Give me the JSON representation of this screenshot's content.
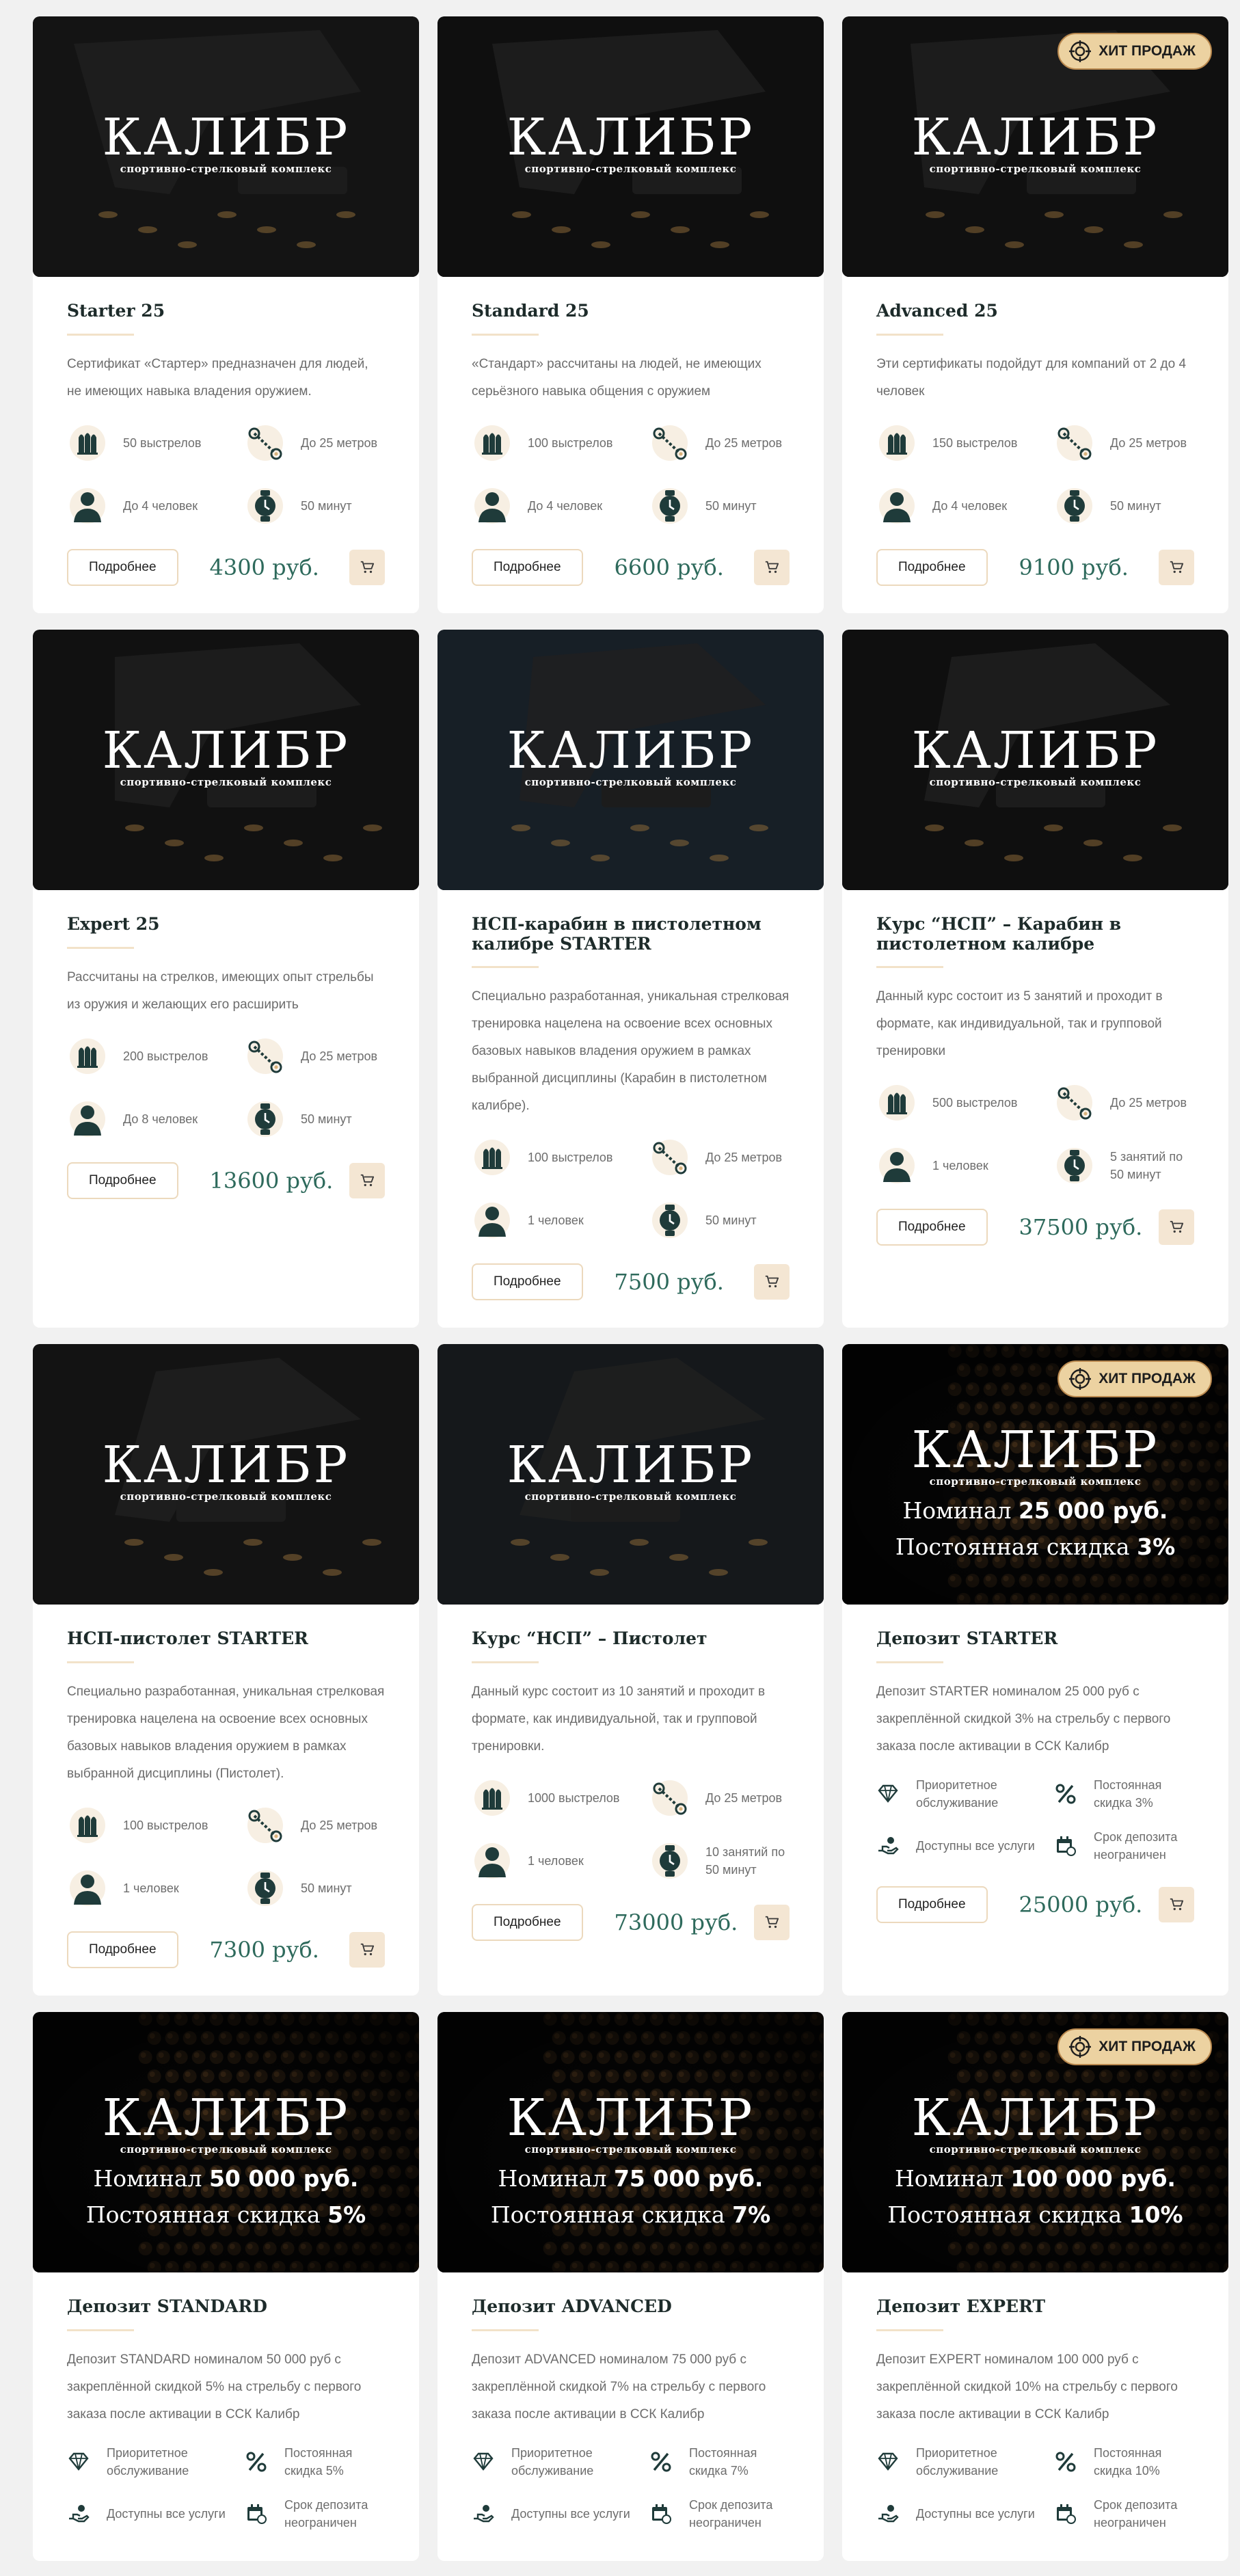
{
  "common": {
    "logo_title": "КАЛИБР",
    "logo_sub": "спортивно-стрелковый комплекс",
    "more_label": "Подробнее",
    "badge_label": "ХИТ ПРОДАЖ",
    "colors": {
      "accent": "#ecd2a1",
      "price": "#2e6a5c",
      "icon": "#1f3b3a",
      "cart_bg": "#f4e6d3"
    }
  },
  "cards": [
    {
      "title": "Starter 25",
      "desc": "Сертификат «Стартер» предназначен для людей, не имеющих навыка владения оружием.",
      "feats": [
        "50 выстрелов",
        "До 25 метров",
        "До 4 человек",
        "50 минут"
      ],
      "price": "4300 руб.",
      "badge": false
    },
    {
      "title": "Standard 25",
      "desc": "«Стандарт» рассчитаны на людей, не имеющих серьёзного навыка общения с оружием",
      "feats": [
        "100 выстрелов",
        "До 25 метров",
        "До 4 человек",
        "50 минут"
      ],
      "price": "6600 руб.",
      "badge": false
    },
    {
      "title": "Advanced 25",
      "desc": "Эти сертификаты подойдут для компаний от 2 до 4 человек",
      "feats": [
        "150 выстрелов",
        "До 25 метров",
        "До 4 человек",
        "50 минут"
      ],
      "price": "9100 руб.",
      "badge": true
    },
    {
      "title": "Expert 25",
      "desc": "Рассчитаны на стрелков, имеющих опыт стрельбы из оружия и желающих его расширить",
      "feats": [
        "200 выстрелов",
        "До 25 метров",
        "До 8 человек",
        "50 минут"
      ],
      "price": "13600 руб.",
      "badge": false
    },
    {
      "title": "НСП-карабин в пистолетном калибре STARTER",
      "desc": "Специально разработанная, уникальная стрелковая тренировка нацелена на освоение всех основных базовых навыков владения оружием в рамках выбранной дисциплины (Карабин в пистолетном калибре).",
      "feats": [
        "100 выстрелов",
        "До 25 метров",
        "1 человек",
        "50 минут"
      ],
      "price": "7500 руб.",
      "badge": false
    },
    {
      "title": "Курс “НСП” – Карабин в пистолетном калибре",
      "desc": "Данный курс состоит из 5 занятий и проходит в формате, как индивидуальной, так и групповой тренировки",
      "feats": [
        "500 выстрелов",
        "До 25 метров",
        "1 человек",
        "5 занятий по 50 минут"
      ],
      "price": "37500 руб.",
      "badge": false
    },
    {
      "title": "НСП-пистолет STARTER",
      "desc": "Специально разработанная, уникальная стрелковая тренировка нацелена на освоение всех основных базовых навыков владения оружием в рамках выбранной дисциплины (Пистолет).",
      "feats": [
        "100 выстрелов",
        "До 25 метров",
        "1 человек",
        "50 минут"
      ],
      "price": "7300 руб.",
      "badge": false
    },
    {
      "title": "Курс “НСП” – Пистолет",
      "desc": "Данный курс состоит из 10 занятий и проходит в формате, как индивидуальной, так и групповой тренировки.",
      "feats": [
        "1000 выстрелов",
        "До 25 метров",
        "1 человек",
        "10 занятий по 50 минут"
      ],
      "price": "73000 руб.",
      "badge": false
    },
    {
      "title": "Депозит STARTER",
      "desc": "Депозит STARTER номиналом 25 000 руб с закреплённой скидкой 3% на стрельбу с первого заказа после активации в ССК Калибр",
      "feats": [
        "Приоритетное обслуживание",
        "Постоянная скидка 3%",
        "Доступны все услуги",
        "Срок депозита неограничен"
      ],
      "price": "25000 руб.",
      "badge": true,
      "deposit": {
        "nominal_label": "Номинал",
        "nominal_value": "25 000 руб.",
        "discount_label": "Постоянная скидка",
        "discount_value": "3%"
      }
    },
    {
      "title": "Депозит STANDARD",
      "desc": "Депозит STANDARD номиналом 50 000 руб с закреплённой скидкой 5% на стрельбу с первого заказа после активации в ССК Калибр",
      "feats": [
        "Приоритетное обслуживание",
        "Постоянная скидка 5%",
        "Доступны все услуги",
        "Срок депозита неограничен"
      ],
      "price": "",
      "badge": false,
      "deposit": {
        "nominal_label": "Номинал",
        "nominal_value": "50 000 руб.",
        "discount_label": "Постоянная скидка",
        "discount_value": "5%"
      }
    },
    {
      "title": "Депозит ADVANCED",
      "desc": "Депозит ADVANCED номиналом 75 000 руб с закреплённой скидкой 7% на стрельбу с первого заказа после активации в ССК Калибр",
      "feats": [
        "Приоритетное обслуживание",
        "Постоянная скидка 7%",
        "Доступны все услуги",
        "Срок депозита неограничен"
      ],
      "price": "",
      "badge": false,
      "deposit": {
        "nominal_label": "Номинал",
        "nominal_value": "75 000 руб.",
        "discount_label": "Постоянная скидка",
        "discount_value": "7%"
      }
    },
    {
      "title": "Депозит EXPERT",
      "desc": "Депозит EXPERT номиналом 100 000 руб с закреплённой скидкой 10% на стрельбу с первого заказа после активации в ССК Калибр",
      "feats": [
        "Приоритетное обслуживание",
        "Постоянная скидка 10%",
        "Доступны все услуги",
        "Срок депозита неограничен"
      ],
      "price": "",
      "badge": true,
      "deposit": {
        "nominal_label": "Номинал",
        "nominal_value": "100 000 руб.",
        "discount_label": "Постоянная скидка",
        "discount_value": "10%"
      }
    }
  ]
}
